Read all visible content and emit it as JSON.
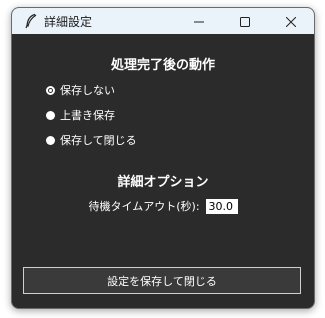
{
  "window": {
    "title": "詳細設定",
    "icon": "feather-icon",
    "controls": [
      "minimize-icon",
      "maximize-icon",
      "close-icon"
    ]
  },
  "post_action": {
    "heading": "処理完了後の動作",
    "options": [
      {
        "label": "保存しない",
        "selected": true
      },
      {
        "label": "上書き保存",
        "selected": false
      },
      {
        "label": "保存して閉じる",
        "selected": false
      }
    ]
  },
  "advanced": {
    "heading": "詳細オプション",
    "timeout_label": "待機タイムアウト(秒):",
    "timeout_value": "30.0"
  },
  "footer": {
    "save_label": "設定を保存して閉じる"
  },
  "colors": {
    "background": "#2b2b2b",
    "titlebar": "#eaf3f9",
    "text": "#ffffff",
    "button_bg": "#3a3a3a",
    "button_border": "#cfcfcf"
  }
}
